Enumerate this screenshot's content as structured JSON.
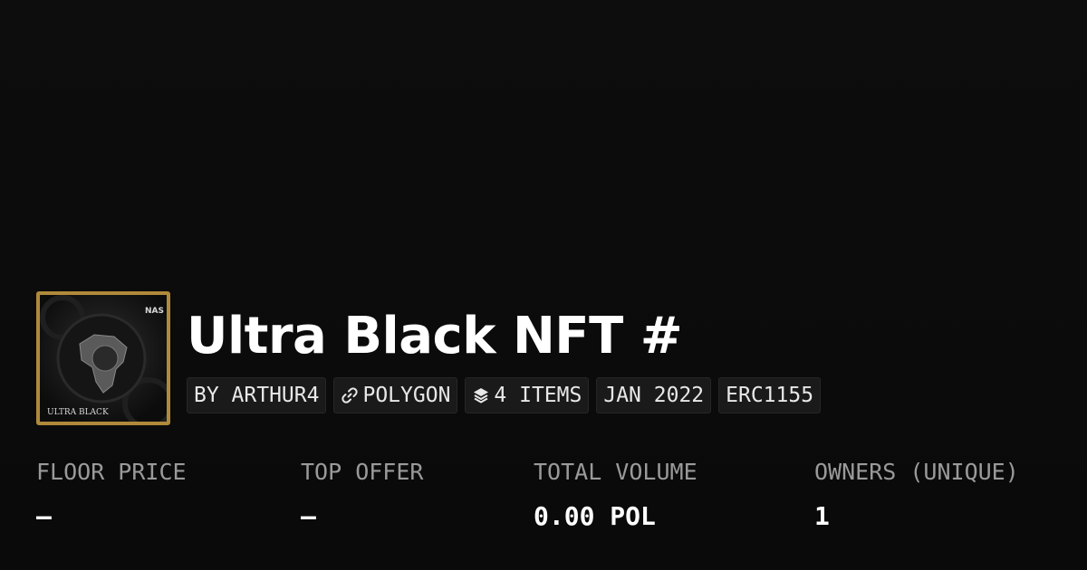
{
  "collection": {
    "title": "Ultra Black NFT #",
    "thumbnail_caption": "ULTRA BLACK",
    "thumbnail_logo": "NAS"
  },
  "tags": [
    {
      "label": "BY ARTHUR4",
      "icon": null
    },
    {
      "label": "POLYGON",
      "icon": "chain-link-icon"
    },
    {
      "label": "4 ITEMS",
      "icon": "stack-layers-icon"
    },
    {
      "label": "JAN 2022",
      "icon": null
    },
    {
      "label": "ERC1155",
      "icon": null
    }
  ],
  "stats": [
    {
      "label": "FLOOR PRICE",
      "value": "–"
    },
    {
      "label": "TOP OFFER",
      "value": "–"
    },
    {
      "label": "TOTAL VOLUME",
      "value": "0.00 POL"
    },
    {
      "label": "OWNERS (UNIQUE)",
      "value": "1"
    }
  ],
  "colors": {
    "background": "#0b0b0b",
    "tag_background": "#1a1a1a",
    "label_gray": "#9a9a9a",
    "frame_gold": "#b08a3a"
  }
}
